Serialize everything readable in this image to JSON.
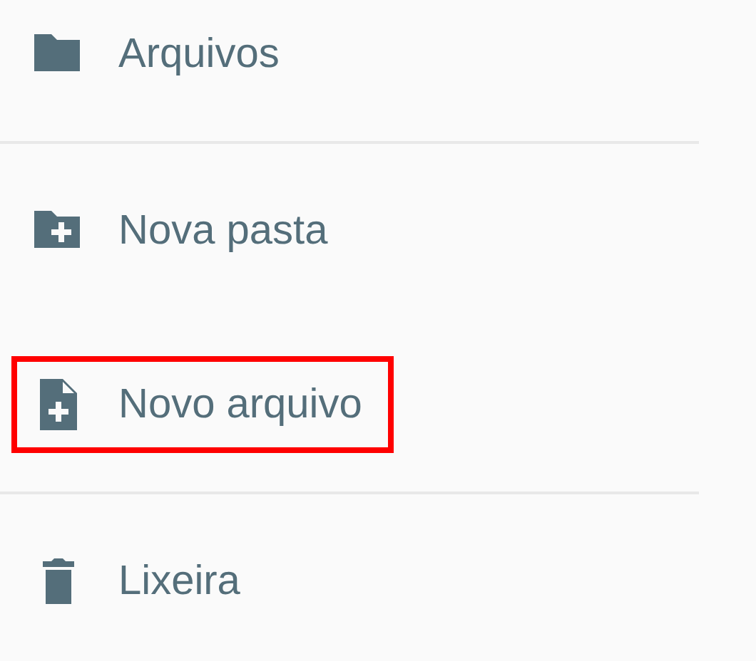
{
  "groups": [
    {
      "items": [
        {
          "kind": "folder",
          "label": "Arquivos",
          "highlighted": false
        }
      ]
    },
    {
      "items": [
        {
          "kind": "new-folder",
          "label": "Nova pasta",
          "highlighted": false
        },
        {
          "kind": "new-file",
          "label": "Novo arquivo",
          "highlighted": true
        }
      ]
    },
    {
      "items": [
        {
          "kind": "trash",
          "label": "Lixeira",
          "highlighted": false
        }
      ]
    }
  ]
}
